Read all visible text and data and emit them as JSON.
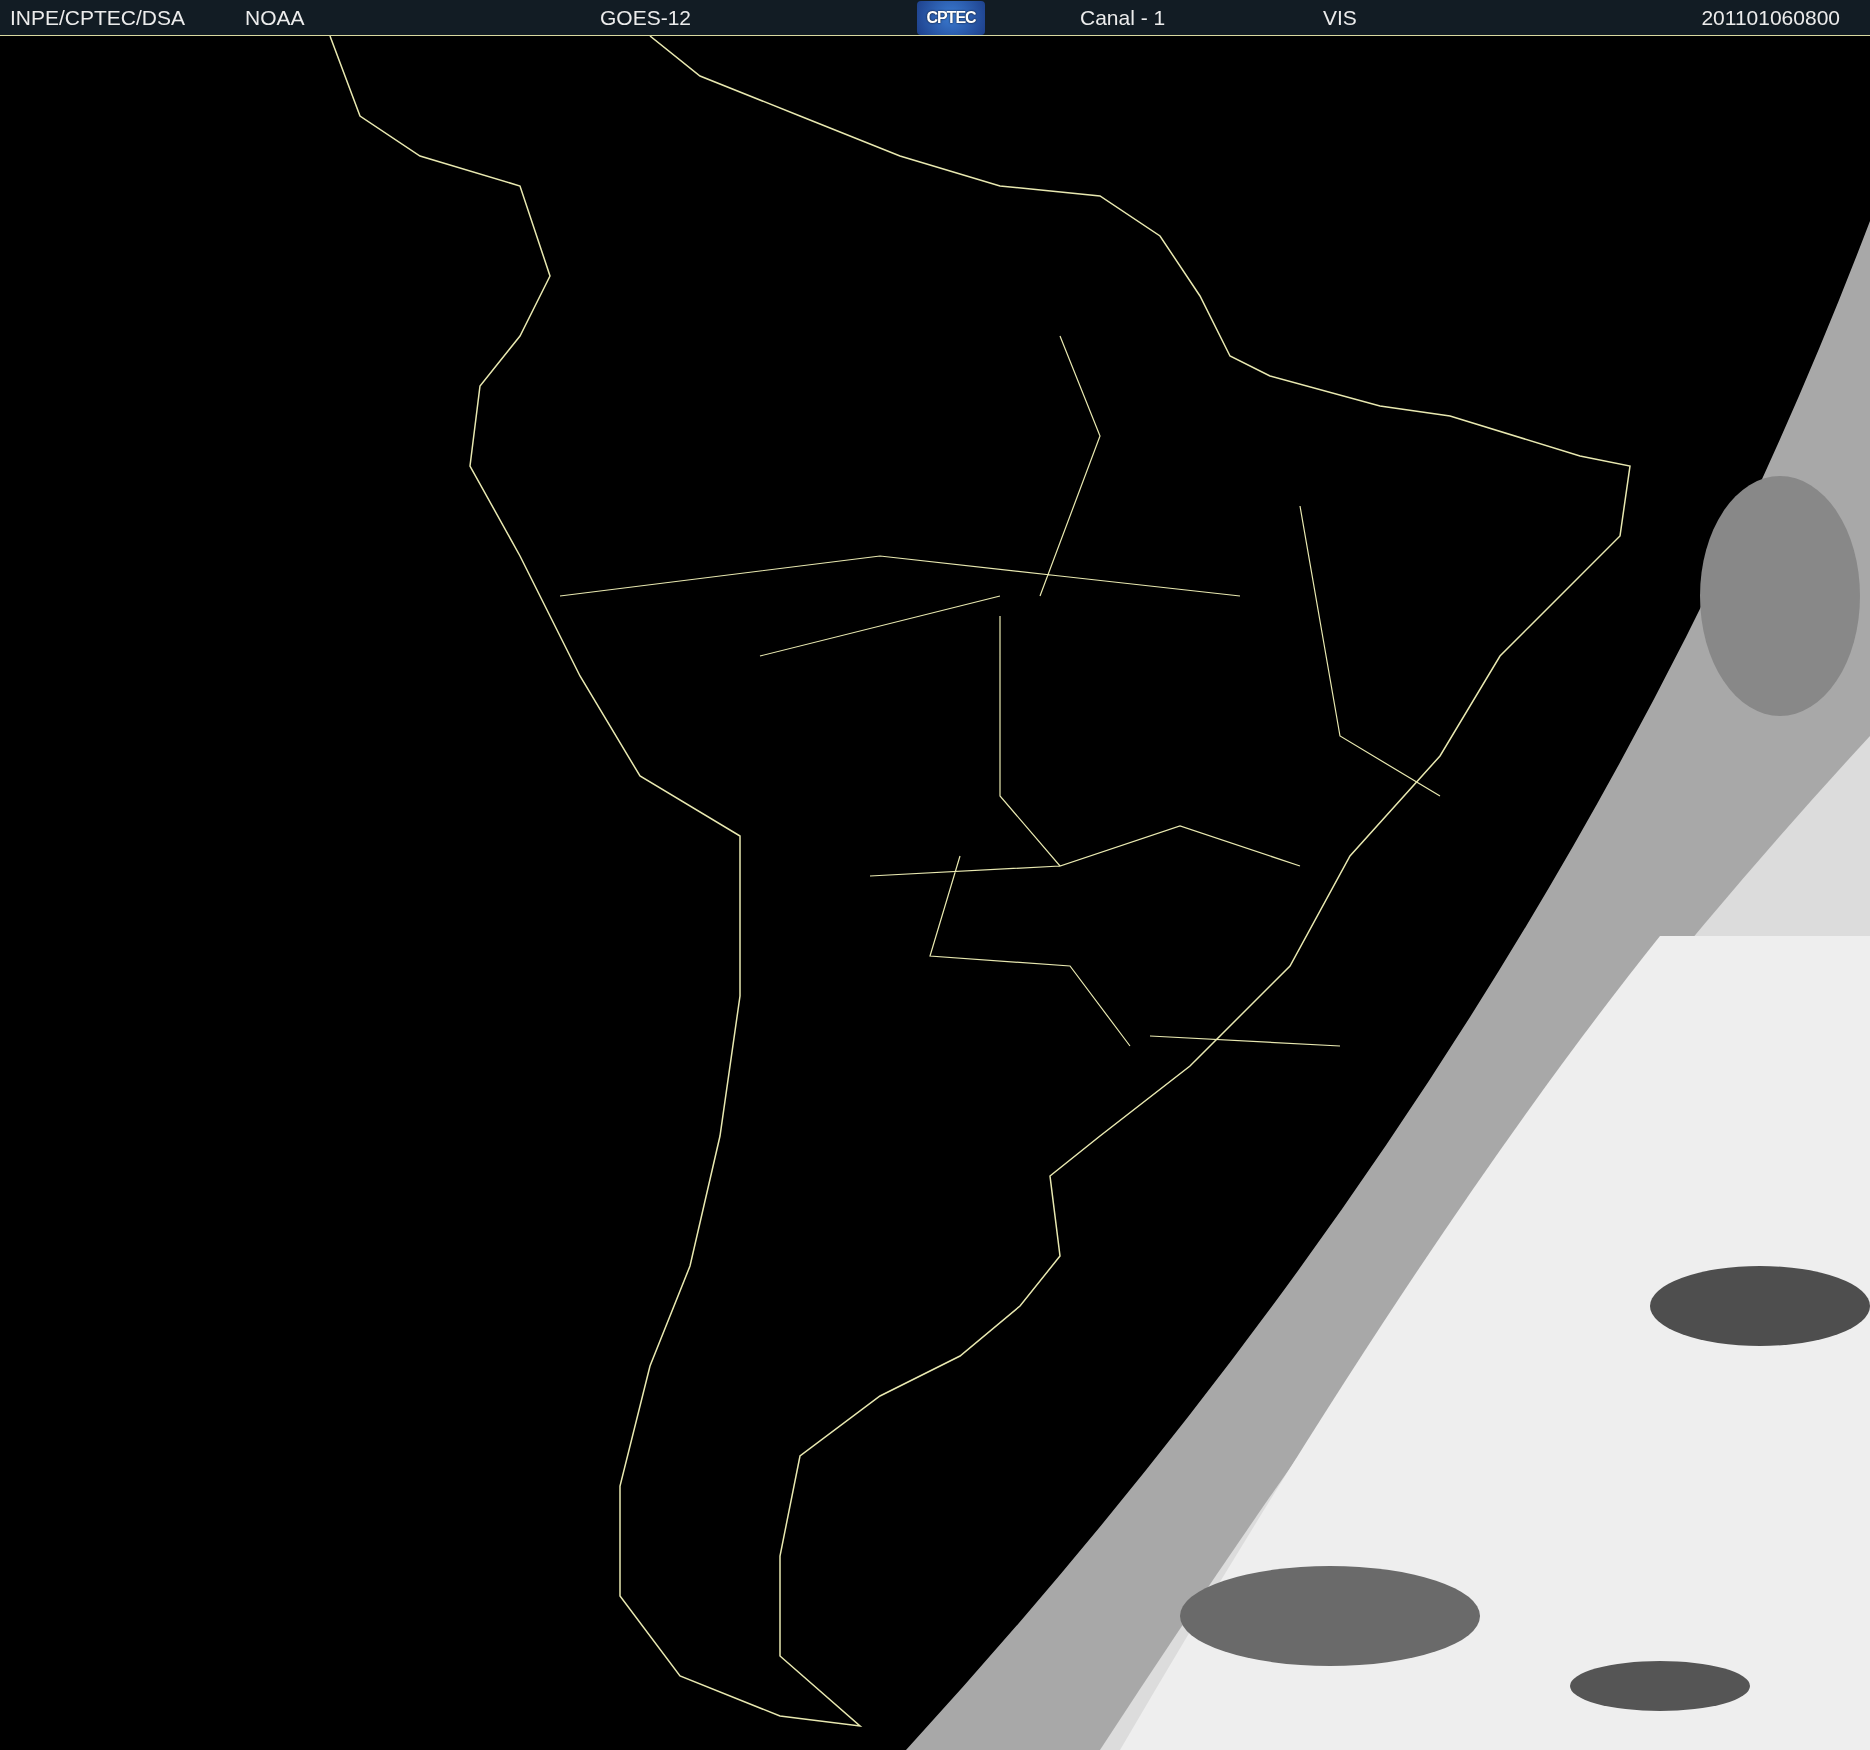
{
  "header": {
    "source": "INPE/CPTEC/DSA",
    "agency": "NOAA",
    "satellite": "GOES-12",
    "logo": "CPTEC",
    "channel": "Canal - 1",
    "band": "VIS",
    "timestamp": "201101060800"
  }
}
